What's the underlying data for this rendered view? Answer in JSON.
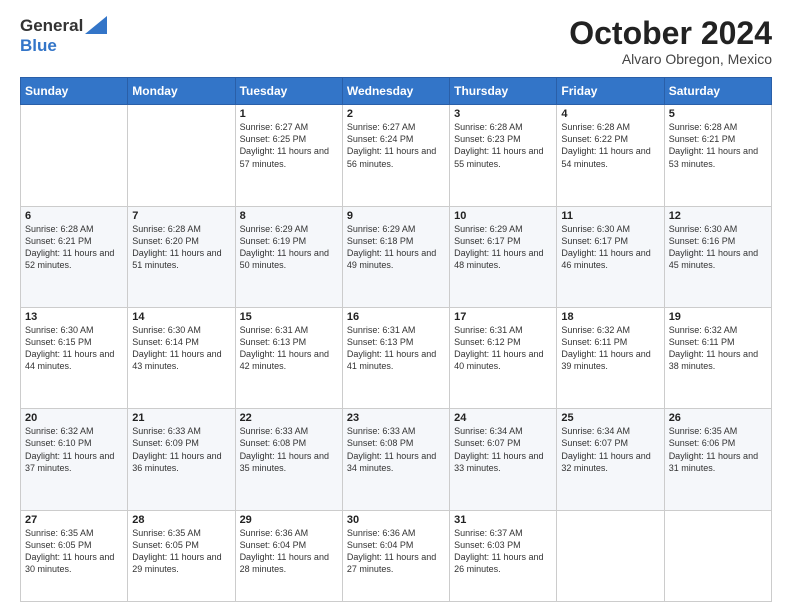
{
  "header": {
    "logo_line1": "General",
    "logo_line2": "Blue",
    "month": "October 2024",
    "location": "Alvaro Obregon, Mexico"
  },
  "weekdays": [
    "Sunday",
    "Monday",
    "Tuesday",
    "Wednesday",
    "Thursday",
    "Friday",
    "Saturday"
  ],
  "weeks": [
    [
      {
        "day": "",
        "sunrise": "",
        "sunset": "",
        "daylight": ""
      },
      {
        "day": "",
        "sunrise": "",
        "sunset": "",
        "daylight": ""
      },
      {
        "day": "1",
        "sunrise": "Sunrise: 6:27 AM",
        "sunset": "Sunset: 6:25 PM",
        "daylight": "Daylight: 11 hours and 57 minutes."
      },
      {
        "day": "2",
        "sunrise": "Sunrise: 6:27 AM",
        "sunset": "Sunset: 6:24 PM",
        "daylight": "Daylight: 11 hours and 56 minutes."
      },
      {
        "day": "3",
        "sunrise": "Sunrise: 6:28 AM",
        "sunset": "Sunset: 6:23 PM",
        "daylight": "Daylight: 11 hours and 55 minutes."
      },
      {
        "day": "4",
        "sunrise": "Sunrise: 6:28 AM",
        "sunset": "Sunset: 6:22 PM",
        "daylight": "Daylight: 11 hours and 54 minutes."
      },
      {
        "day": "5",
        "sunrise": "Sunrise: 6:28 AM",
        "sunset": "Sunset: 6:21 PM",
        "daylight": "Daylight: 11 hours and 53 minutes."
      }
    ],
    [
      {
        "day": "6",
        "sunrise": "Sunrise: 6:28 AM",
        "sunset": "Sunset: 6:21 PM",
        "daylight": "Daylight: 11 hours and 52 minutes."
      },
      {
        "day": "7",
        "sunrise": "Sunrise: 6:28 AM",
        "sunset": "Sunset: 6:20 PM",
        "daylight": "Daylight: 11 hours and 51 minutes."
      },
      {
        "day": "8",
        "sunrise": "Sunrise: 6:29 AM",
        "sunset": "Sunset: 6:19 PM",
        "daylight": "Daylight: 11 hours and 50 minutes."
      },
      {
        "day": "9",
        "sunrise": "Sunrise: 6:29 AM",
        "sunset": "Sunset: 6:18 PM",
        "daylight": "Daylight: 11 hours and 49 minutes."
      },
      {
        "day": "10",
        "sunrise": "Sunrise: 6:29 AM",
        "sunset": "Sunset: 6:17 PM",
        "daylight": "Daylight: 11 hours and 48 minutes."
      },
      {
        "day": "11",
        "sunrise": "Sunrise: 6:30 AM",
        "sunset": "Sunset: 6:17 PM",
        "daylight": "Daylight: 11 hours and 46 minutes."
      },
      {
        "day": "12",
        "sunrise": "Sunrise: 6:30 AM",
        "sunset": "Sunset: 6:16 PM",
        "daylight": "Daylight: 11 hours and 45 minutes."
      }
    ],
    [
      {
        "day": "13",
        "sunrise": "Sunrise: 6:30 AM",
        "sunset": "Sunset: 6:15 PM",
        "daylight": "Daylight: 11 hours and 44 minutes."
      },
      {
        "day": "14",
        "sunrise": "Sunrise: 6:30 AM",
        "sunset": "Sunset: 6:14 PM",
        "daylight": "Daylight: 11 hours and 43 minutes."
      },
      {
        "day": "15",
        "sunrise": "Sunrise: 6:31 AM",
        "sunset": "Sunset: 6:13 PM",
        "daylight": "Daylight: 11 hours and 42 minutes."
      },
      {
        "day": "16",
        "sunrise": "Sunrise: 6:31 AM",
        "sunset": "Sunset: 6:13 PM",
        "daylight": "Daylight: 11 hours and 41 minutes."
      },
      {
        "day": "17",
        "sunrise": "Sunrise: 6:31 AM",
        "sunset": "Sunset: 6:12 PM",
        "daylight": "Daylight: 11 hours and 40 minutes."
      },
      {
        "day": "18",
        "sunrise": "Sunrise: 6:32 AM",
        "sunset": "Sunset: 6:11 PM",
        "daylight": "Daylight: 11 hours and 39 minutes."
      },
      {
        "day": "19",
        "sunrise": "Sunrise: 6:32 AM",
        "sunset": "Sunset: 6:11 PM",
        "daylight": "Daylight: 11 hours and 38 minutes."
      }
    ],
    [
      {
        "day": "20",
        "sunrise": "Sunrise: 6:32 AM",
        "sunset": "Sunset: 6:10 PM",
        "daylight": "Daylight: 11 hours and 37 minutes."
      },
      {
        "day": "21",
        "sunrise": "Sunrise: 6:33 AM",
        "sunset": "Sunset: 6:09 PM",
        "daylight": "Daylight: 11 hours and 36 minutes."
      },
      {
        "day": "22",
        "sunrise": "Sunrise: 6:33 AM",
        "sunset": "Sunset: 6:08 PM",
        "daylight": "Daylight: 11 hours and 35 minutes."
      },
      {
        "day": "23",
        "sunrise": "Sunrise: 6:33 AM",
        "sunset": "Sunset: 6:08 PM",
        "daylight": "Daylight: 11 hours and 34 minutes."
      },
      {
        "day": "24",
        "sunrise": "Sunrise: 6:34 AM",
        "sunset": "Sunset: 6:07 PM",
        "daylight": "Daylight: 11 hours and 33 minutes."
      },
      {
        "day": "25",
        "sunrise": "Sunrise: 6:34 AM",
        "sunset": "Sunset: 6:07 PM",
        "daylight": "Daylight: 11 hours and 32 minutes."
      },
      {
        "day": "26",
        "sunrise": "Sunrise: 6:35 AM",
        "sunset": "Sunset: 6:06 PM",
        "daylight": "Daylight: 11 hours and 31 minutes."
      }
    ],
    [
      {
        "day": "27",
        "sunrise": "Sunrise: 6:35 AM",
        "sunset": "Sunset: 6:05 PM",
        "daylight": "Daylight: 11 hours and 30 minutes."
      },
      {
        "day": "28",
        "sunrise": "Sunrise: 6:35 AM",
        "sunset": "Sunset: 6:05 PM",
        "daylight": "Daylight: 11 hours and 29 minutes."
      },
      {
        "day": "29",
        "sunrise": "Sunrise: 6:36 AM",
        "sunset": "Sunset: 6:04 PM",
        "daylight": "Daylight: 11 hours and 28 minutes."
      },
      {
        "day": "30",
        "sunrise": "Sunrise: 6:36 AM",
        "sunset": "Sunset: 6:04 PM",
        "daylight": "Daylight: 11 hours and 27 minutes."
      },
      {
        "day": "31",
        "sunrise": "Sunrise: 6:37 AM",
        "sunset": "Sunset: 6:03 PM",
        "daylight": "Daylight: 11 hours and 26 minutes."
      },
      {
        "day": "",
        "sunrise": "",
        "sunset": "",
        "daylight": ""
      },
      {
        "day": "",
        "sunrise": "",
        "sunset": "",
        "daylight": ""
      }
    ]
  ]
}
